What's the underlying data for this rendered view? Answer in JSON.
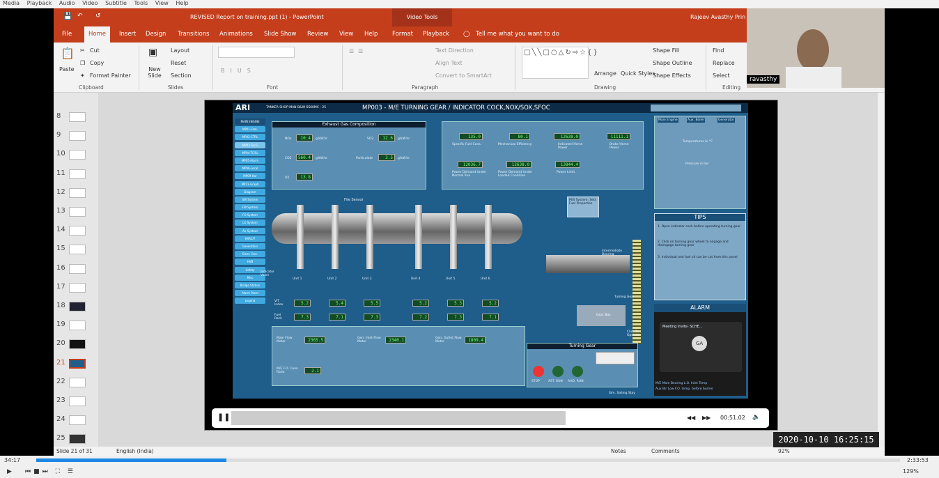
{
  "player_menu": [
    "Media",
    "Playback",
    "Audio",
    "Video",
    "Subtitle",
    "Tools",
    "View",
    "Help"
  ],
  "titlebar": {
    "doc_title": "REVISED Report on training.ppt (1)  -  PowerPoint",
    "context_tools": "Video Tools",
    "user": "Rajeev Avasthy Prin"
  },
  "tabs": [
    "File",
    "Home",
    "Insert",
    "Design",
    "Transitions",
    "Animations",
    "Slide Show",
    "Review",
    "View",
    "Help",
    "Format",
    "Playback"
  ],
  "tell_me": "Tell me what you want to do",
  "ribbon": {
    "clipboard": {
      "paste": "Paste",
      "cut": "Cut",
      "copy": "Copy",
      "format_painter": "Format Painter",
      "label": "Clipboard"
    },
    "slides": {
      "new_slide": "New Slide",
      "layout": "Layout",
      "reset": "Reset",
      "section": "Section",
      "label": "Slides"
    },
    "font": {
      "label": "Font"
    },
    "paragraph": {
      "text_direction": "Text Direction",
      "align_text": "Align Text",
      "convert": "Convert to SmartArt",
      "label": "Paragraph"
    },
    "drawing": {
      "arrange": "Arrange",
      "quick_styles": "Quick Styles",
      "shape_fill": "Shape Fill",
      "shape_outline": "Shape Outline",
      "shape_effects": "Shape Effects",
      "label": "Drawing"
    },
    "editing": {
      "find": "Find",
      "replace": "Replace",
      "select": "Select",
      "label": "Editing"
    }
  },
  "webcam_name": "ravasthy",
  "thumbnails": [
    "8",
    "9",
    "10",
    "11",
    "12",
    "13",
    "14",
    "15",
    "16",
    "17",
    "18",
    "19",
    "20",
    "21",
    "22",
    "23",
    "24",
    "25"
  ],
  "statusbar": {
    "slide": "Slide 21 of 31",
    "language": "English (India)",
    "notes": "Notes",
    "comments": "Comments",
    "zoom": "92%"
  },
  "sim": {
    "brand": "ARI",
    "subtitle": "TANKER SHOP-MAN B&W 6S60MC - 25",
    "title": "MP003 - M/E TURNING GEAR / INDICATOR COCK,NOX/SOX,SFOC",
    "buttons": [
      "MAIN ENGINE",
      "MP01-Fam.",
      "MP02-CTRL",
      "MP03 Tur.G",
      "MP04-TC/Sc",
      "MP05-Alarm",
      "MP06-Local",
      "MP09-Har",
      "MP11-Graph",
      "Diagram",
      "SW System",
      "FW System",
      "FO System",
      "LO System",
      "Air System",
      "HVAC/T",
      "Generators",
      "Emer. Gen.",
      "HVB",
      "Safety",
      "Misc",
      "Bridge Station",
      "Alarm Panel",
      "Legend"
    ],
    "exhaust": {
      "title": "Exhaust Gas Composition",
      "no2_lbl": "NOx",
      "no2": "10.4",
      "so2_lbl": "SO2",
      "so2": "12.6",
      "co2_lbl": "CO2",
      "co2": "560.4",
      "part_lbl": "Particulate",
      "part": "3.5",
      "o2_lbl": "O2",
      "o2": "13.8",
      "unit": "g/kW.hr"
    },
    "perf": {
      "sfc": "135.0",
      "sfc_lbl": "Specific Fuel Cons.",
      "mech": "80.1",
      "mech_lbl": "Mechanical Efficiency",
      "ind": "12638.0",
      "ind_lbl": "Indicated Horse Power",
      "brake": "11111.1",
      "brake_lbl": "Brake Horse Power",
      "pdn": "12036.7",
      "pdn_lbl": "Power Demand Under Normal Run",
      "pdl": "12638.0",
      "pdl_lbl": "Power Demand Under Loaded Condition",
      "pl": "13844.4",
      "pl_lbl": "Power Limit"
    },
    "vit_lbl": "VIT Index",
    "vit": [
      "5.2",
      "5.4",
      "5.5",
      "5.2",
      "5.3",
      "5.2"
    ],
    "rack_lbl": "Fuel Rack",
    "rack": [
      "7.3",
      "7.1",
      "7.3",
      "7.2",
      "7.3",
      "7.1"
    ],
    "units": [
      "Unit 1",
      "Unit 2",
      "Unit 3",
      "Unit 4",
      "Unit 5",
      "Unit 6"
    ],
    "fire_sensor": "Fire Sensor",
    "indicator_valve": "Indicator Valve",
    "inter_bearing": "Intermediate Bearing",
    "turning_gear_lbl": "Turning Gear",
    "gear_box": "Gear Box",
    "click_operate": "Click To Operate",
    "flow": {
      "main": "2365.5",
      "main_lbl": "Main Flow Meter",
      "gen": "2340.1",
      "gen_lbl": "Gen. Inlet Flow Meter",
      "gen_out": "1809.4",
      "gen_out_lbl": "Gen. Outlet Flow Meter",
      "ratio": "2.1",
      "ratio_lbl": "M/E F.O. Cons. Ratio"
    },
    "tg_panel": {
      "title": "Turning Gear",
      "stop": "STOP",
      "ast": "AST. RUN",
      "ahd": "AHD. RUN"
    },
    "right_tabs": [
      "Main Engine",
      "Aux. Boiler",
      "Generator"
    ],
    "temps_title": "Temperatures in °C",
    "press_title": "Pressure in bar",
    "tips_title": "TIPS",
    "tips": [
      "1. Open indicator cock before operating turning gear",
      "2. Click on turning gear wheel to engage and disengage turning gear",
      "3. Individual and fuel oil can be cut from this panel"
    ],
    "alarm_title": "ALARM",
    "meeting": "Meeting Invite- SCHE...",
    "avatar": "GA",
    "alarm_line1": "M/E Main Bearing L.O. Inlet Temp",
    "alarm_line2": "Aux Blr Low F.O. temp. before burner",
    "footer": "Sim. Sailing Stay",
    "ms_lbl": "M/S System: Sets Fuel Properties"
  },
  "video_controls": {
    "elapsed": "00:51.02"
  },
  "timestamp": "2020-10-10 16:25:15",
  "player": {
    "current": "34:17",
    "total": "2:33:53",
    "volume": "129%"
  }
}
